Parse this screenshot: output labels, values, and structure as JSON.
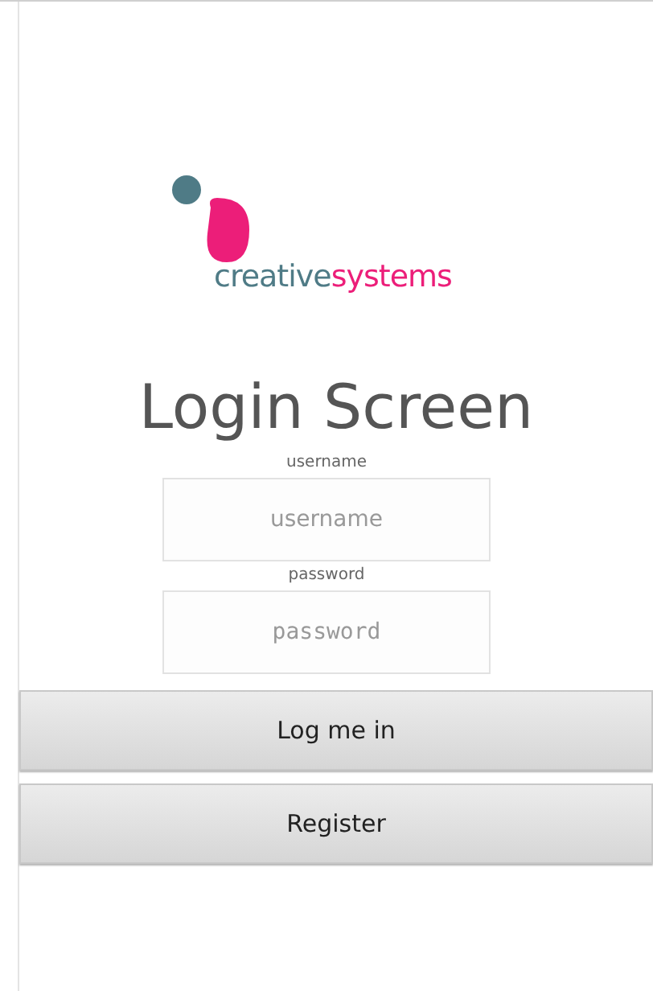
{
  "logo": {
    "parts": [
      {
        "text": "creative",
        "color": "#4f7b86"
      },
      {
        "text": "systems",
        "color": "#ec1e79"
      }
    ]
  },
  "title": "Login Screen",
  "fields": [
    {
      "label": "username",
      "placeholder": "username",
      "kind": "text"
    },
    {
      "label": "password",
      "placeholder": "password",
      "kind": "password"
    }
  ],
  "buttons": [
    "Log me in",
    "Register"
  ]
}
